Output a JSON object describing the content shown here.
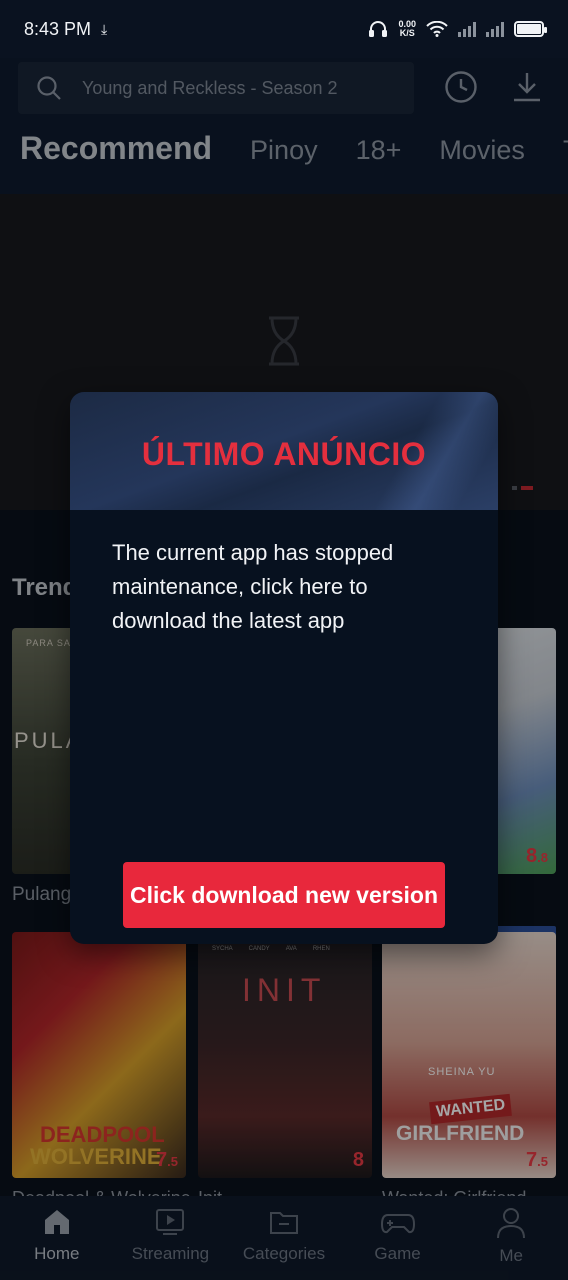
{
  "status_bar": {
    "time": "8:43 PM",
    "net_speed_value": "0.00",
    "net_speed_unit": "K/S"
  },
  "search": {
    "placeholder": "Young and Reckless - Season 2"
  },
  "tabs": [
    "Recommend",
    "Pinoy",
    "18+",
    "Movies",
    "T"
  ],
  "active_tab": 0,
  "section": {
    "title": "Trend"
  },
  "posters": {
    "p1": {
      "top_text": "PARA SA",
      "title_text": "PULA"
    },
    "p2": {
      "rating_main": "8",
      "rating_decimal": ".8"
    },
    "row2_label": "Pulang",
    "p3": {
      "line1": "DEADPOOL",
      "line2": "WOLVERINE",
      "rating_main": "7",
      "rating_decimal": ".5"
    },
    "p4": {
      "title": "INIT",
      "names": [
        "SYCHA",
        "CANDY",
        "AVA",
        "RHEN"
      ],
      "rating_main": "8",
      "rating_decimal": ""
    },
    "p5": {
      "name": "SHEINA YU",
      "badge": "WANTED",
      "title": "GIRLFRIEND",
      "rating_main": "7",
      "rating_decimal": ".5"
    }
  },
  "clipped_titles": [
    "Deadpool & Wolverine",
    "Init",
    "Wanted: Girlfriend"
  ],
  "bottom_nav": [
    {
      "label": "Home",
      "icon": "home-icon"
    },
    {
      "label": "Streaming",
      "icon": "play-screen-icon"
    },
    {
      "label": "Categories",
      "icon": "folder-icon"
    },
    {
      "label": "Game",
      "icon": "gamepad-icon"
    },
    {
      "label": "Me",
      "icon": "person-icon"
    }
  ],
  "dialog": {
    "title": "ÚLTIMO ANÚNCIO",
    "message": "The current app has stopped maintenance, click here to download the latest app",
    "button_label": "Click download new version"
  },
  "colors": {
    "accent_red": "#e8283c",
    "title_red": "#e42f3e",
    "background": "#0a111c"
  }
}
